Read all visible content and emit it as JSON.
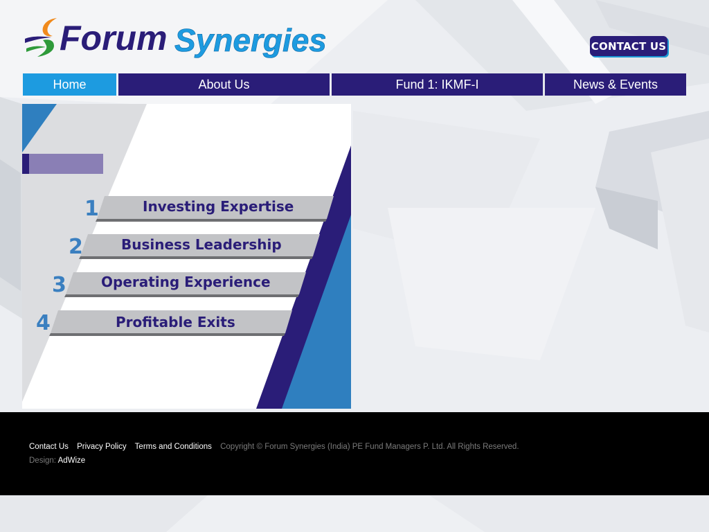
{
  "header": {
    "brand_part1": "Forum",
    "brand_part2": "Synergies",
    "logo_icon": "swoosh-logo-icon",
    "contact_label": "CONTACT US"
  },
  "nav": {
    "items": [
      {
        "label": "Home",
        "active": true
      },
      {
        "label": "About Us",
        "active": false
      },
      {
        "label": "Fund 1: IKMF-I",
        "active": false
      },
      {
        "label": "News & Events",
        "active": false
      }
    ]
  },
  "banner": {
    "items": [
      {
        "number": "1",
        "label": "Investing Expertise"
      },
      {
        "number": "2",
        "label": "Business Leadership"
      },
      {
        "number": "3",
        "label": "Operating Experience"
      },
      {
        "number": "4",
        "label": "Profitable Exits"
      }
    ]
  },
  "footer": {
    "links": [
      "Contact Us",
      "Privacy Policy",
      "Terms and Conditions"
    ],
    "copyright": "Copyright © Forum Synergies (India) PE Fund Managers P. Ltd. All Rights Reserved.",
    "design_label": "Design:",
    "design_by": "AdWize"
  },
  "colors": {
    "brand_navy": "#2a1d78",
    "brand_blue": "#1d9be0",
    "accent_orange": "#f08a1c",
    "accent_green": "#2e9a3a",
    "footer_bg": "#000000"
  }
}
